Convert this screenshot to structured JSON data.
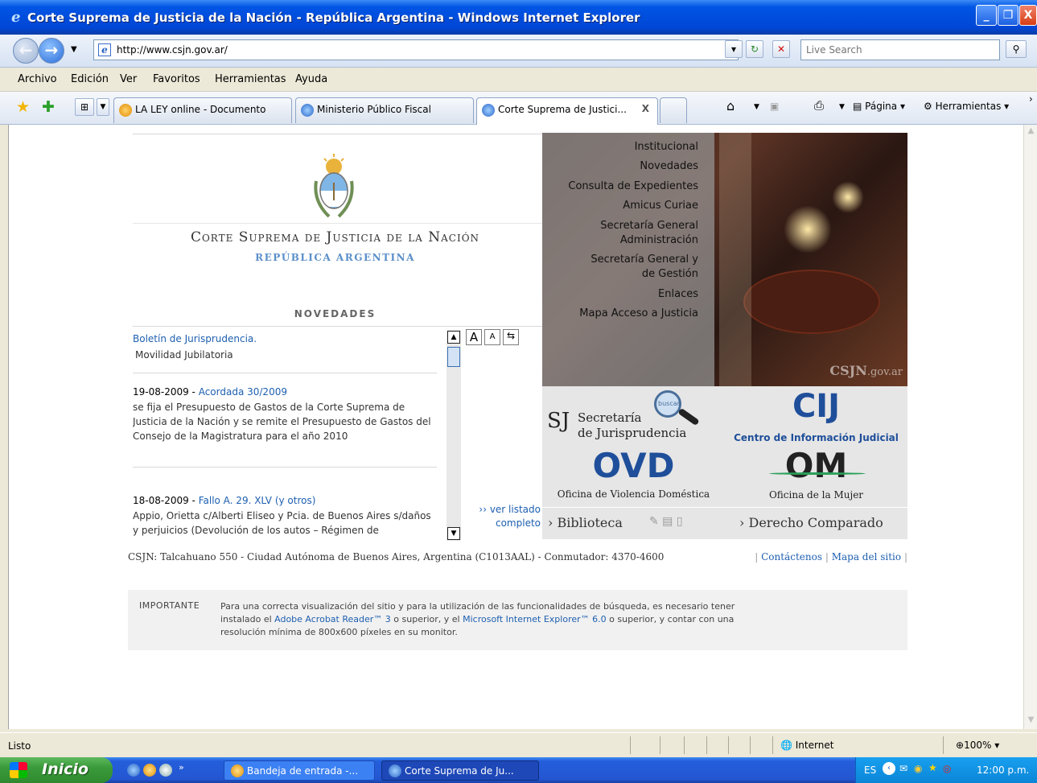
{
  "window": {
    "title": "Corte Suprema de Justicia de la Nación - República Argentina - Windows Internet Explorer",
    "buttons": {
      "minimize": "_",
      "restore": "❐",
      "close": "X"
    }
  },
  "address_bar": {
    "url": "http://www.csjn.gov.ar/",
    "search_placeholder": "Live Search"
  },
  "menu": [
    "Archivo",
    "Edición",
    "Ver",
    "Favoritos",
    "Herramientas",
    "Ayuda"
  ],
  "tabs": [
    {
      "label": "LA LEY online - Documento",
      "icon": "laley-icon"
    },
    {
      "label": "Ministerio Público Fiscal",
      "icon": "ie-icon"
    },
    {
      "label": "Corte Suprema de Justici...",
      "icon": "ie-icon",
      "active": true,
      "close": "X"
    }
  ],
  "command_bar": {
    "page": "Página",
    "tools": "Herramientas"
  },
  "site": {
    "court_title": "Corte Suprema de Justicia de la Nación",
    "republic": "REPÚBLICA ARGENTINA",
    "novedades_heading": "NOVEDADES",
    "font_buttons": [
      "A",
      "A",
      "⇆"
    ],
    "news": [
      {
        "link": "Boletín de Jurisprudencia.",
        "text": "Movilidad Jubilatoria"
      },
      {
        "date": "19-08-2009 - ",
        "link": "Acordada 30/2009",
        "text": "se fija el Presupuesto de Gastos de la Corte Suprema de Justicia de la Nación y se remite el Presupuesto de Gastos del Consejo de la Magistratura para el año 2010"
      },
      {
        "date": "18-08-2009 - ",
        "link": "Fallo A. 29. XLV (y otros)",
        "text": "Appio, Orietta c/Alberti Eliseo y Pcia. de Buenos Aires s/daños y perjuicios (Devolución de los autos – Régimen de"
      }
    ],
    "ver_listado": "›› ver listado completo",
    "nav": [
      "Institucional",
      "Novedades",
      "Consulta de Expedientes",
      "Amicus Curiae",
      "Secretaría General Administración",
      "Secretaría General y de Gestión",
      "Enlaces",
      "Mapa Acceso a Justicia"
    ],
    "photo_mark": "CSJN",
    "photo_mark_suffix": ".gov.ar",
    "tiles": {
      "sj_letters": "SJ",
      "sj_line1": "Secretaría",
      "sj_line2": "de Jurisprudencia",
      "sj_lens": "buscar",
      "cij_logo": "CIJ",
      "cij_label": "Centro de Información Judicial",
      "ovd_logo": "OVD",
      "ovd_label": "Oficina de Violencia Doméstica",
      "om_logo": "OM",
      "om_label": "Oficina de la Mujer",
      "biblioteca": "› Biblioteca",
      "derecho": "› Derecho Comparado"
    },
    "footer": {
      "address": "CSJN: Talcahuano 550 - Ciudad Autónoma de Buenos Aires, Argentina (C1013AAL) - Conmutador: 4370-4600",
      "contact": "Contáctenos",
      "sitemap": "Mapa del sitio"
    },
    "important": {
      "label": "IMPORTANTE",
      "t1": "Para una correcta visualización del sitio y para la utilización de las funcionalidades de búsqueda, es necesario tener instalado el ",
      "link1": "Adobe Acrobat Reader™ 3",
      "t2": " o superior, y el ",
      "link2": "Microsoft Internet Explorer™ 6.0",
      "t3": " o superior, y contar con una resolución mínima de 800x600 píxeles en su monitor."
    }
  },
  "status_bar": {
    "text": "Listo",
    "zone": "Internet",
    "zoom": "100%"
  },
  "taskbar": {
    "start": "Inicio",
    "buttons": [
      "Bandeja de entrada -...",
      "Corte Suprema de Ju..."
    ],
    "tray_lang": "ES",
    "clock": "12:00 p.m."
  },
  "colors": {
    "link": "#1d5fb0",
    "republic": "#5b8fc9",
    "xp_blue": "#0055e5"
  }
}
